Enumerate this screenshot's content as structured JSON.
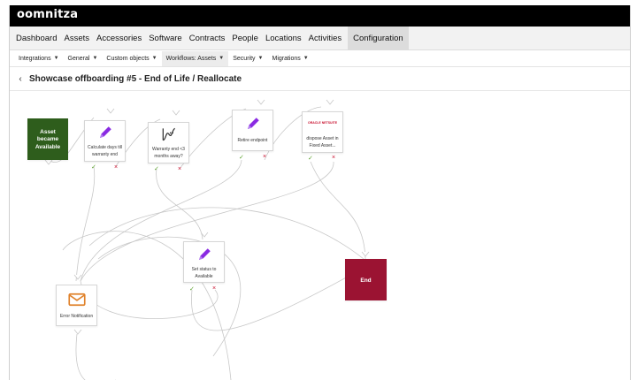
{
  "app": {
    "logo": "oomnitza"
  },
  "main_nav": [
    {
      "label": "Dashboard"
    },
    {
      "label": "Assets"
    },
    {
      "label": "Accessories"
    },
    {
      "label": "Software"
    },
    {
      "label": "Contracts"
    },
    {
      "label": "People"
    },
    {
      "label": "Locations"
    },
    {
      "label": "Activities"
    },
    {
      "label": "Configuration",
      "active": true
    }
  ],
  "sub_nav": [
    {
      "label": "Integrations"
    },
    {
      "label": "General"
    },
    {
      "label": "Custom objects"
    },
    {
      "label": "Workflows: Assets",
      "active": true
    },
    {
      "label": "Security"
    },
    {
      "label": "Migrations"
    }
  ],
  "page": {
    "back_icon": "chevron-left-icon",
    "title": "Showcase offboarding #5 - End of Life / Reallocate"
  },
  "workflow": {
    "colors": {
      "start": "#2e5d1c",
      "end": "#9b1332",
      "yes": "#5aa02c",
      "no": "#c8102e",
      "pencil": "#8a2be2",
      "mail": "#e0822b"
    },
    "nodes": {
      "start": {
        "label": "Asset became Available"
      },
      "calc": {
        "label": "Calculate days till warranty end",
        "icon": "pencil-icon"
      },
      "warranty": {
        "label": "Warranty end <3 months away?",
        "icon": "condition-icon"
      },
      "retire": {
        "label": "Retire endpoint",
        "icon": "pencil-icon"
      },
      "dispose": {
        "label": "dispose Asset in Fixed Asset...",
        "icon": "oracle-logo",
        "logo_text": "ORACLE NETSUITE"
      },
      "set_status": {
        "label": "Set status to Available",
        "icon": "pencil-icon"
      },
      "error": {
        "label": "Error Notification",
        "icon": "mail-icon"
      },
      "end": {
        "label": "End"
      }
    },
    "ports": {
      "yes": "✓",
      "no": "×"
    }
  }
}
